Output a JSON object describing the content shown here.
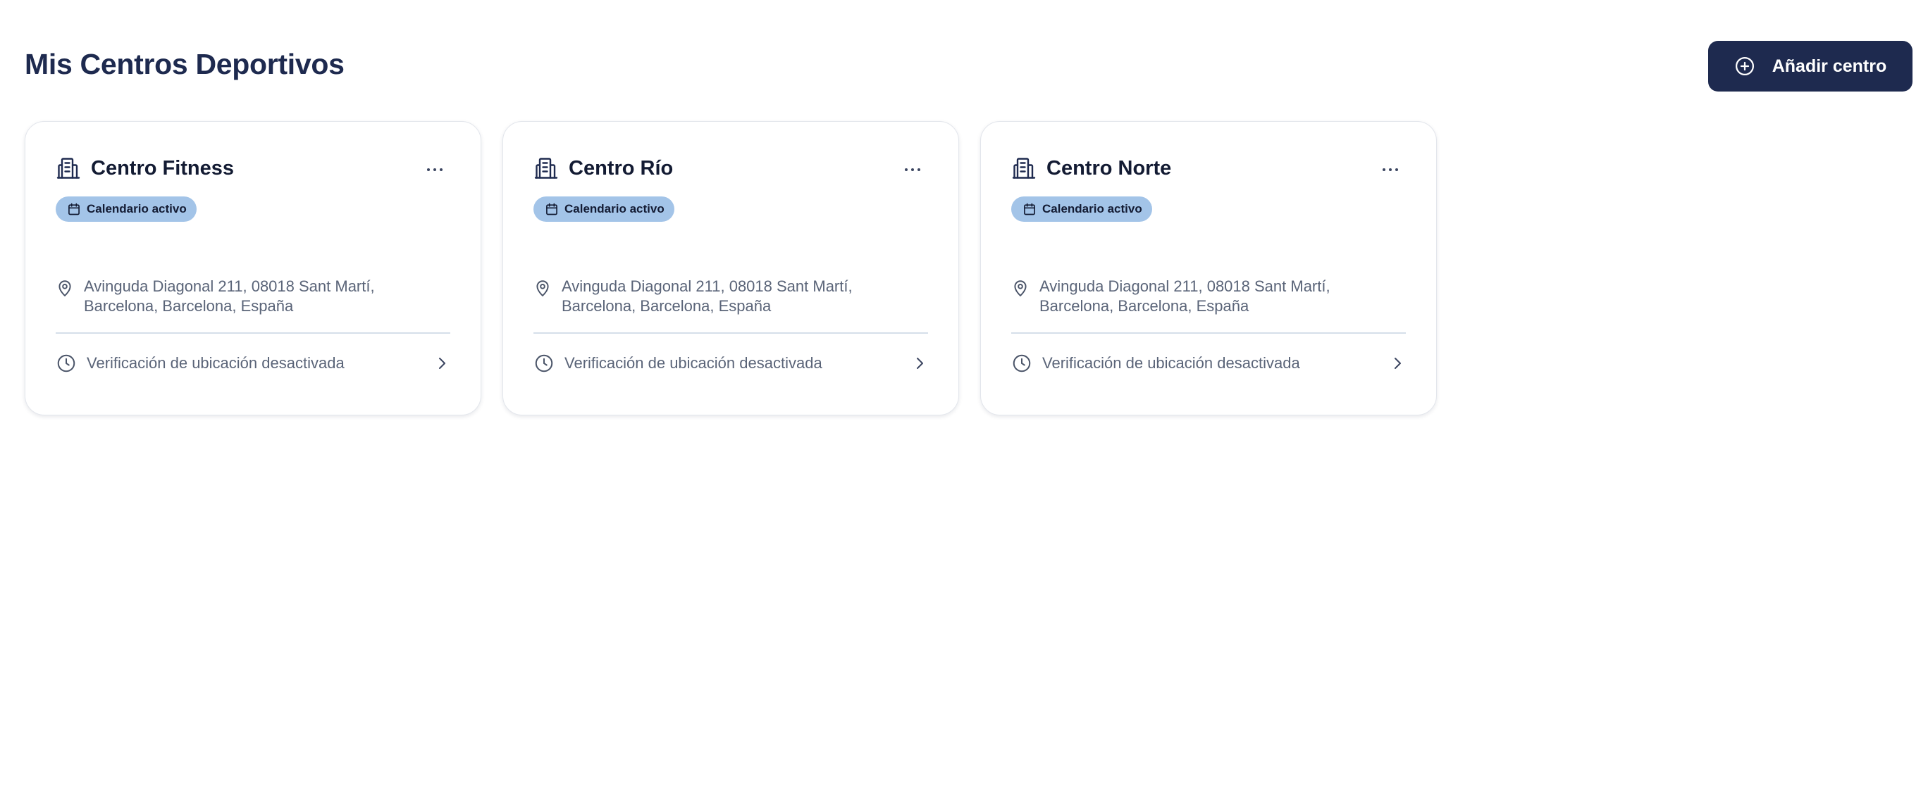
{
  "header": {
    "title": "Mis Centros Deportivos",
    "add_button_label": "Añadir centro",
    "add_button_icon": "plus-circle-icon"
  },
  "colors": {
    "primary": "#1e2a4f",
    "badge_bg": "#a3c4e8",
    "muted_text": "#5a6478",
    "divider": "#d5dfea"
  },
  "centers": [
    {
      "name": "Centro Fitness",
      "badge": "Calendario activo",
      "address": "Avinguda Diagonal 211, 08018 Sant Martí, Barcelona, Barcelona, España",
      "verification": "Verificación de ubicación desactivada"
    },
    {
      "name": "Centro Río",
      "badge": "Calendario activo",
      "address": "Avinguda Diagonal 211, 08018 Sant Martí, Barcelona, Barcelona, España",
      "verification": "Verificación de ubicación desactivada"
    },
    {
      "name": "Centro Norte",
      "badge": "Calendario activo",
      "address": "Avinguda Diagonal 211, 08018 Sant Martí, Barcelona, Barcelona, España",
      "verification": "Verificación de ubicación desactivada"
    }
  ]
}
